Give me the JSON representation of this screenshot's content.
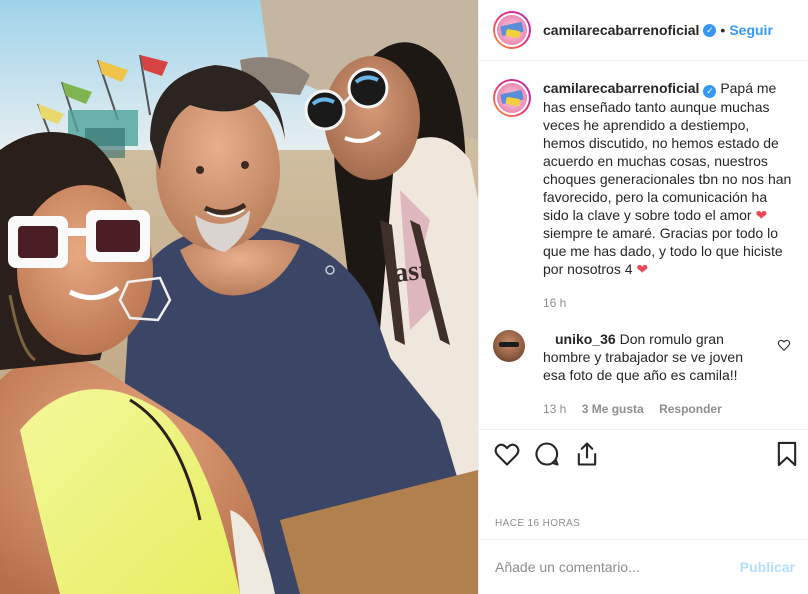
{
  "header": {
    "username": "camilarecabarrenoficial",
    "separator": "•",
    "follow_label": "Seguir"
  },
  "caption": {
    "username": "camilarecabarrenoficial",
    "text_part1": "Papá me has enseñado tanto aunque muchas veces he aprendido a destiempo, hemos discutido, no hemos estado de acuerdo en muchas cosas, nuestros choques generacionales tbn no nos han favorecido, pero la comunicación ha sido la clave y sobre todo el amor",
    "heart1": "❤",
    "text_part2": "siempre te amaré. Gracias por todo lo que me has dado, y todo lo que hiciste por nosotros 4",
    "heart2": "❤",
    "time": "16 h"
  },
  "reply": {
    "username": "uniko_36",
    "text": "Don romulo gran hombre y trabajador se ve joven esa foto de que año es camila!!",
    "time": "13 h",
    "likes": "3 Me gusta",
    "reply_label": "Responder"
  },
  "post": {
    "timestamp": "HACE 16 HORAS"
  },
  "add_comment": {
    "placeholder": "Añade un comentario...",
    "publish_label": "Publicar"
  },
  "colors": {
    "accent": "#3897f0",
    "publish_disabled": "#b2dffc",
    "muted": "#8e8e8e",
    "heart": "#ed4956"
  }
}
